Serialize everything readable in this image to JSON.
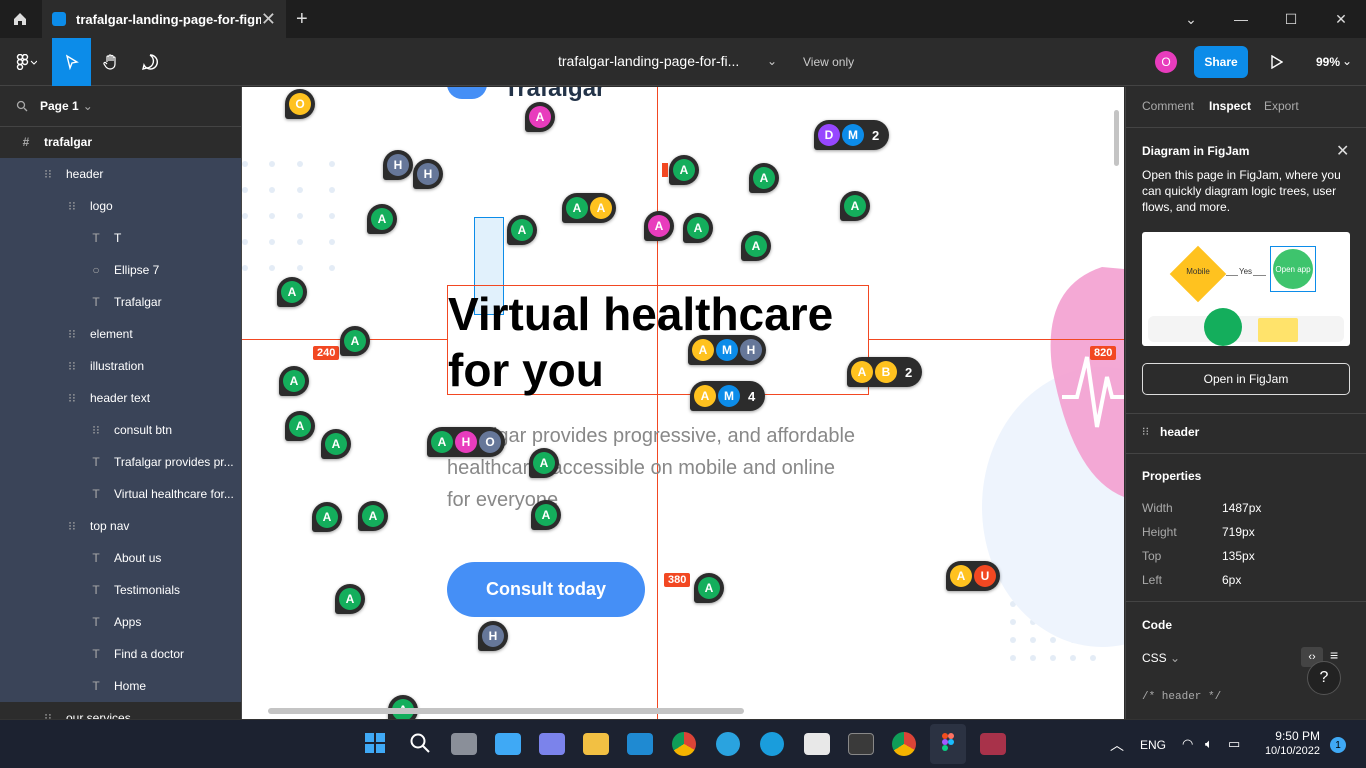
{
  "window": {
    "tab_title": "trafalgar-landing-page-for-figma",
    "tab_close": "✕",
    "new_tab": "+"
  },
  "toolbar": {
    "file_name": "trafalgar-landing-page-for-fi...",
    "view_only": "View only",
    "avatar_initial": "O",
    "share_label": "Share",
    "zoom": "99%"
  },
  "layers": {
    "page": "Page 1",
    "items": [
      {
        "label": "trafalgar",
        "icon": "frame-icon"
      },
      {
        "label": "header",
        "icon": "autolayout-icon"
      },
      {
        "label": "logo",
        "icon": "autolayout-icon"
      },
      {
        "label": "T",
        "icon": "text-icon"
      },
      {
        "label": "Ellipse 7",
        "icon": "ellipse-icon"
      },
      {
        "label": "Trafalgar",
        "icon": "text-icon"
      },
      {
        "label": "element",
        "icon": "autolayout-icon"
      },
      {
        "label": "illustration",
        "icon": "autolayout-icon"
      },
      {
        "label": "header text",
        "icon": "autolayout-icon"
      },
      {
        "label": "consult btn",
        "icon": "autolayout-icon"
      },
      {
        "label": "Trafalgar provides pr...",
        "icon": "text-icon"
      },
      {
        "label": "Virtual healthcare for...",
        "icon": "text-icon"
      },
      {
        "label": "top nav",
        "icon": "autolayout-icon"
      },
      {
        "label": "About us",
        "icon": "text-icon"
      },
      {
        "label": "Testimonials",
        "icon": "text-icon"
      },
      {
        "label": "Apps",
        "icon": "text-icon"
      },
      {
        "label": "Find a doctor",
        "icon": "text-icon"
      },
      {
        "label": "Home",
        "icon": "text-icon"
      },
      {
        "label": "our services",
        "icon": "autolayout-icon"
      }
    ]
  },
  "canvas": {
    "headline_line1": "Virtual healthcare",
    "headline_line2": "for you",
    "subtext_line1": "Trafalgar provides progressive, and affordable",
    "subtext_line2": "healthcare, accessible on mobile and online",
    "subtext_line3": "for everyone",
    "consult_label": "Consult today",
    "logo_text": "Trafalgar",
    "measures": [
      "240",
      "820",
      "380"
    ],
    "group_counts": [
      "2",
      "2",
      "4"
    ]
  },
  "inspect": {
    "tabs": [
      "Comment",
      "Inspect",
      "Export"
    ],
    "banner_title": "Diagram in FigJam",
    "banner_text": "Open this page in FigJam, where you can quickly diagram logic trees, user flows, and more.",
    "diagram_mobile": "Mobile",
    "diagram_yes": "Yes",
    "diagram_open": "Open app",
    "open_figjam": "Open in FigJam",
    "selected_layer": "header",
    "properties_title": "Properties",
    "properties": [
      {
        "label": "Width",
        "value": "1487px"
      },
      {
        "label": "Height",
        "value": "719px"
      },
      {
        "label": "Top",
        "value": "135px"
      },
      {
        "label": "Left",
        "value": "6px"
      }
    ],
    "code_title": "Code",
    "code_lang": "CSS",
    "code_comment": "/* header */",
    "help": "?"
  },
  "taskbar": {
    "lang": "ENG",
    "time": "9:50 PM",
    "date": "10/10/2022",
    "notif": "1"
  },
  "colors": {
    "accent": "#0c8ce9",
    "green": "#14ae5c",
    "pink": "#e83cbd",
    "yellow": "#ffc21f",
    "blue": "#0c8ce9",
    "slate": "#667799",
    "purple": "#9747ff",
    "orange": "#f24822"
  }
}
